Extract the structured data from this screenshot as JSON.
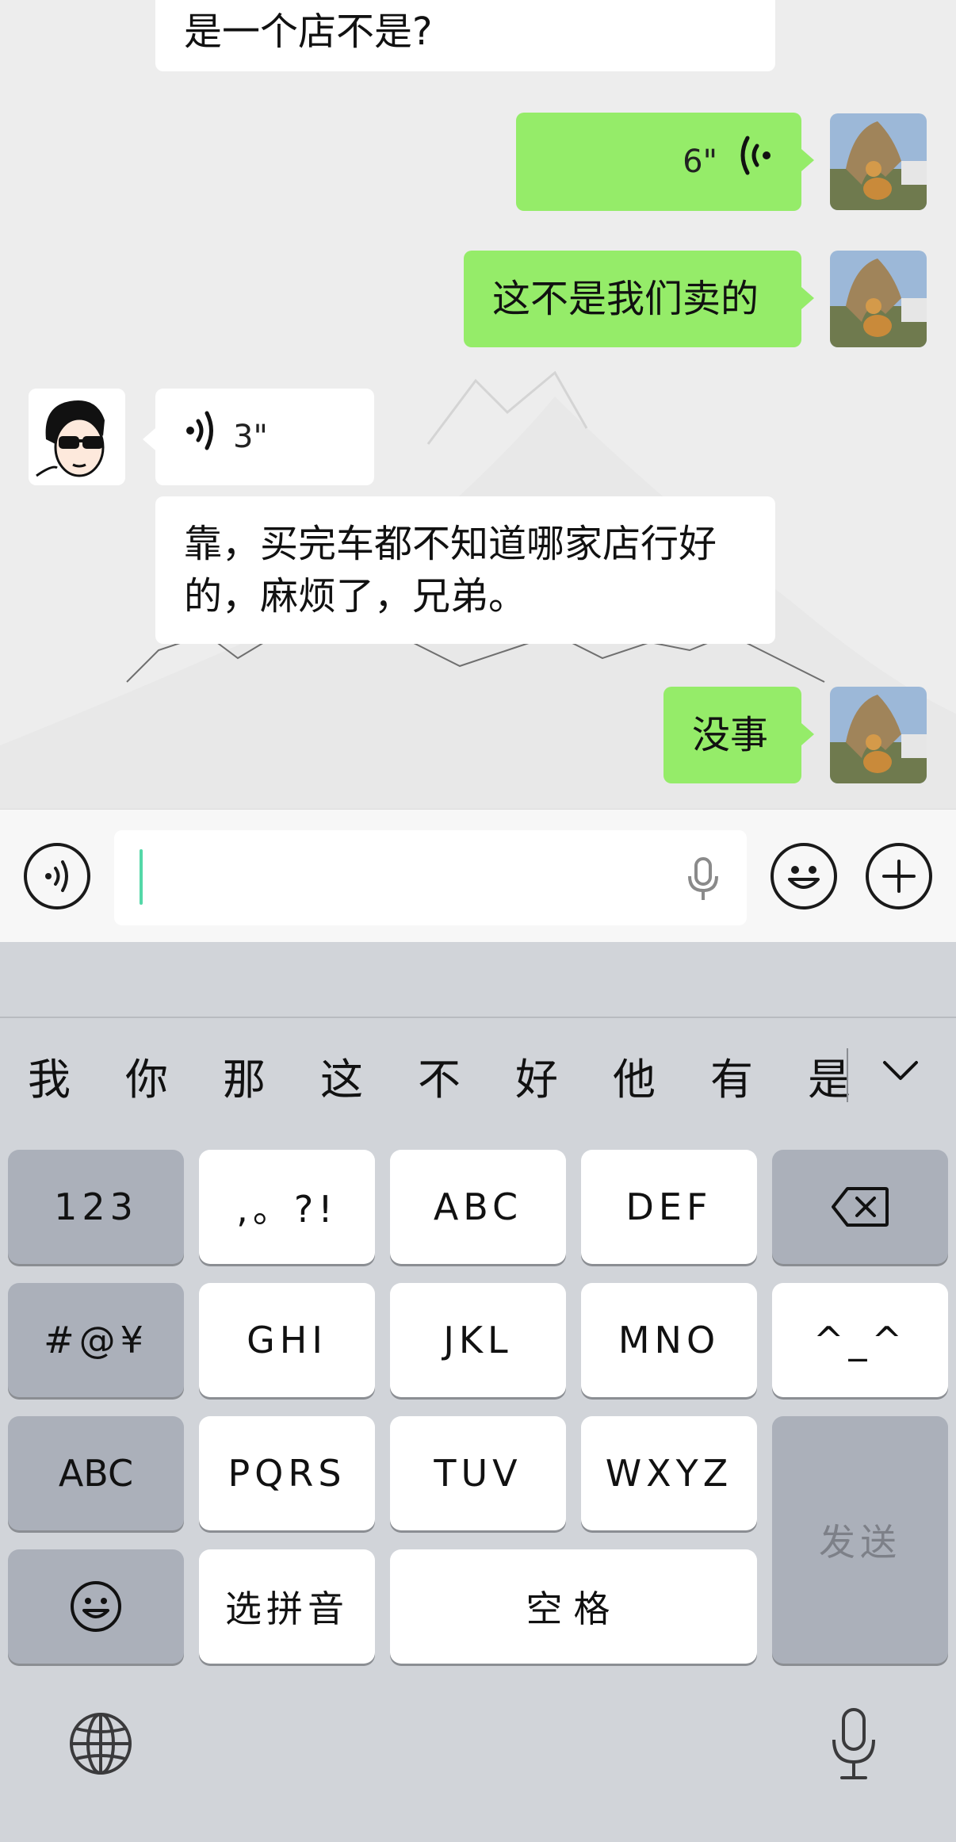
{
  "messages": [
    {
      "side": "in",
      "type": "text",
      "text": "是一个店不是?"
    },
    {
      "side": "out",
      "type": "voice",
      "duration": "6\""
    },
    {
      "side": "out",
      "type": "text",
      "text": "这不是我们卖的"
    },
    {
      "side": "in",
      "type": "voice",
      "duration": "3\""
    },
    {
      "side": "in",
      "type": "text",
      "line1": "靠，买完车都不知道哪家店行好",
      "line2": "的，麻烦了，兄弟。"
    },
    {
      "side": "out",
      "type": "text",
      "text": "没事"
    }
  ],
  "input": {
    "value": "",
    "placeholder": ""
  },
  "candidates": [
    "我",
    "你",
    "那",
    "这",
    "不",
    "好",
    "他",
    "有",
    "是"
  ],
  "keys": {
    "row1": [
      "123",
      ",。?!",
      "ABC",
      "DEF"
    ],
    "row2": [
      "#@¥",
      "GHI",
      "JKL",
      "MNO",
      "^_^"
    ],
    "row3": [
      "ABC",
      "PQRS",
      "TUV",
      "WXYZ"
    ],
    "row4": [
      "选拼音",
      "空格"
    ],
    "send": "发送"
  },
  "colors": {
    "outgoing_bubble": "#95ec69",
    "incoming_bubble": "#ffffff",
    "chat_bg": "#ededed",
    "keyboard_bg": "#d1d4d9",
    "caret": "#54d8a8"
  }
}
